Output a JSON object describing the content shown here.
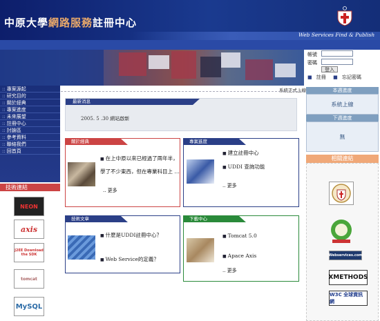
{
  "header": {
    "title_prefix": "中原大學",
    "title_highlight": "網路服務",
    "title_suffix": "註冊中心",
    "tagline": "Web Services Find & Publish"
  },
  "login": {
    "account_label": "帳號",
    "password_label": "密碼",
    "login_button": "登入",
    "register_link": "註冊",
    "forgot_link": "忘記密碼"
  },
  "sidebar": {
    "items": [
      "專案源起",
      "研究目的",
      "關於經典",
      "專案進度",
      "未來展望",
      "註冊中心",
      "討論區",
      "參考資料",
      "聯絡我們",
      "回首頁"
    ]
  },
  "tech": {
    "header": "技術連結",
    "logos": [
      "NEON",
      "axis",
      "J2EE Download the SDK",
      "tomcat",
      "MySQL"
    ]
  },
  "marquee": "系統正式上線",
  "news": {
    "header": "最新消息",
    "entry": "2005. 5 .30 網站啟新"
  },
  "panels": {
    "about": {
      "header": "關於經典",
      "line1": "在上中原以來已經過了兩年半，",
      "line2": "學了不少東西，但在專業科目上 …",
      "more": "更多"
    },
    "progress": {
      "header": "專案進度",
      "items": [
        "建立註冊中心",
        "UDDI 查詢功能"
      ],
      "more": "更多"
    },
    "tech_articles": {
      "header": "技術文章",
      "items": [
        "什麼是UDDI註冊中心？",
        "Web Service的定義？"
      ]
    },
    "downloads": {
      "header": "下載中心",
      "items": [
        "Tomcat 5.0",
        "Apace Axis"
      ],
      "more": "更多"
    }
  },
  "right": {
    "status_header": "本週進度",
    "status_body": "系統上線",
    "next_header": "下週進度",
    "next_body": "無",
    "related_header": "相關連結",
    "related_logos": [
      "CYCU seal",
      "green emblem",
      "Webservices.com",
      "XMETHODS",
      "W3C 全球資訊網"
    ]
  },
  "colors": {
    "header_bg": "#0d1e6b",
    "accent_red": "#c44",
    "accent_blue": "#2b3f87",
    "accent_green": "#2a8a3a",
    "related_orange": "#f0a878"
  }
}
